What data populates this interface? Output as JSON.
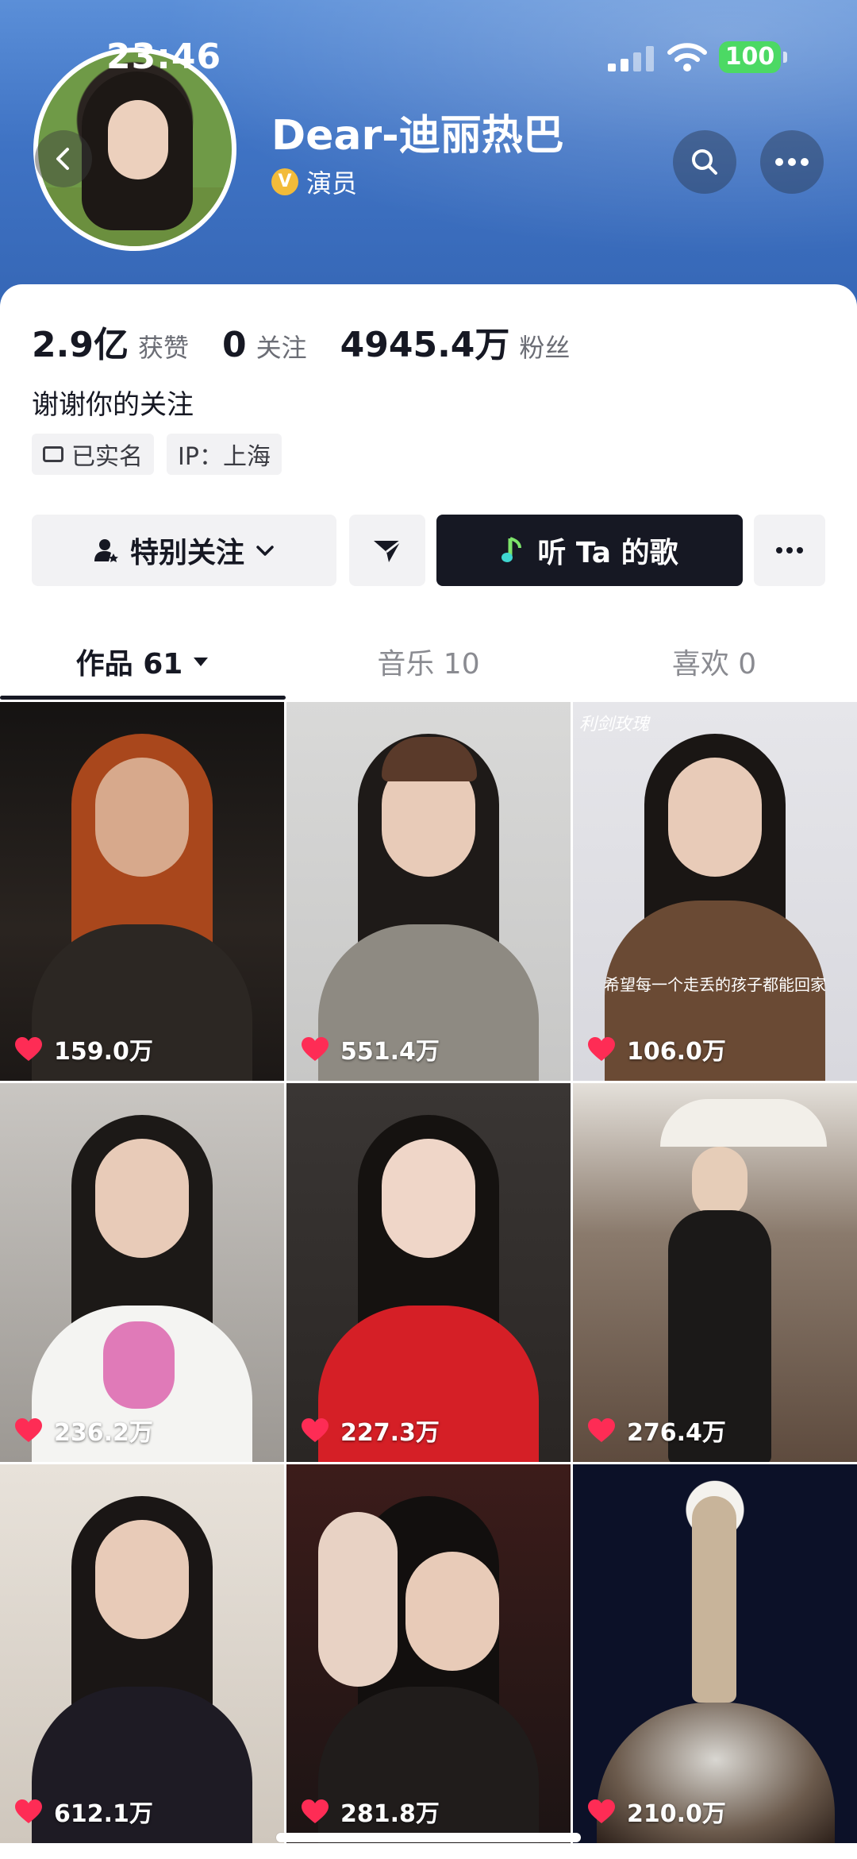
{
  "status_bar": {
    "time": "23:46",
    "battery": "100"
  },
  "profile": {
    "name": "Dear-迪丽热巴",
    "verified_label": "演员",
    "bio": "谢谢你的关注"
  },
  "stats": [
    {
      "value": "2.9亿",
      "label": "获赞"
    },
    {
      "value": "0",
      "label": "关注"
    },
    {
      "value": "4945.4万",
      "label": "粉丝"
    }
  ],
  "tags": {
    "real_name": "已实名",
    "ip": "IP：上海"
  },
  "actions": {
    "follow": "特别关注",
    "music": "听 Ta 的歌"
  },
  "tabs": [
    {
      "label": "作品 61"
    },
    {
      "label": "音乐 10"
    },
    {
      "label": "喜欢 0"
    }
  ],
  "videos": [
    {
      "likes": "159.0万"
    },
    {
      "likes": "551.4万"
    },
    {
      "likes": "106.0万",
      "caption": "希望每一个走丢的孩子都能回家",
      "overlay": "利剑玫瑰"
    },
    {
      "likes": "236.2万"
    },
    {
      "likes": "227.3万"
    },
    {
      "likes": "276.4万"
    },
    {
      "likes": "612.1万"
    },
    {
      "likes": "281.8万"
    },
    {
      "likes": "210.0万"
    }
  ],
  "colors": {
    "accent_dark": "#161823",
    "like_red": "#fe2c55",
    "header_blue": "#3f73c4",
    "verified_gold": "#f2bb3a"
  }
}
